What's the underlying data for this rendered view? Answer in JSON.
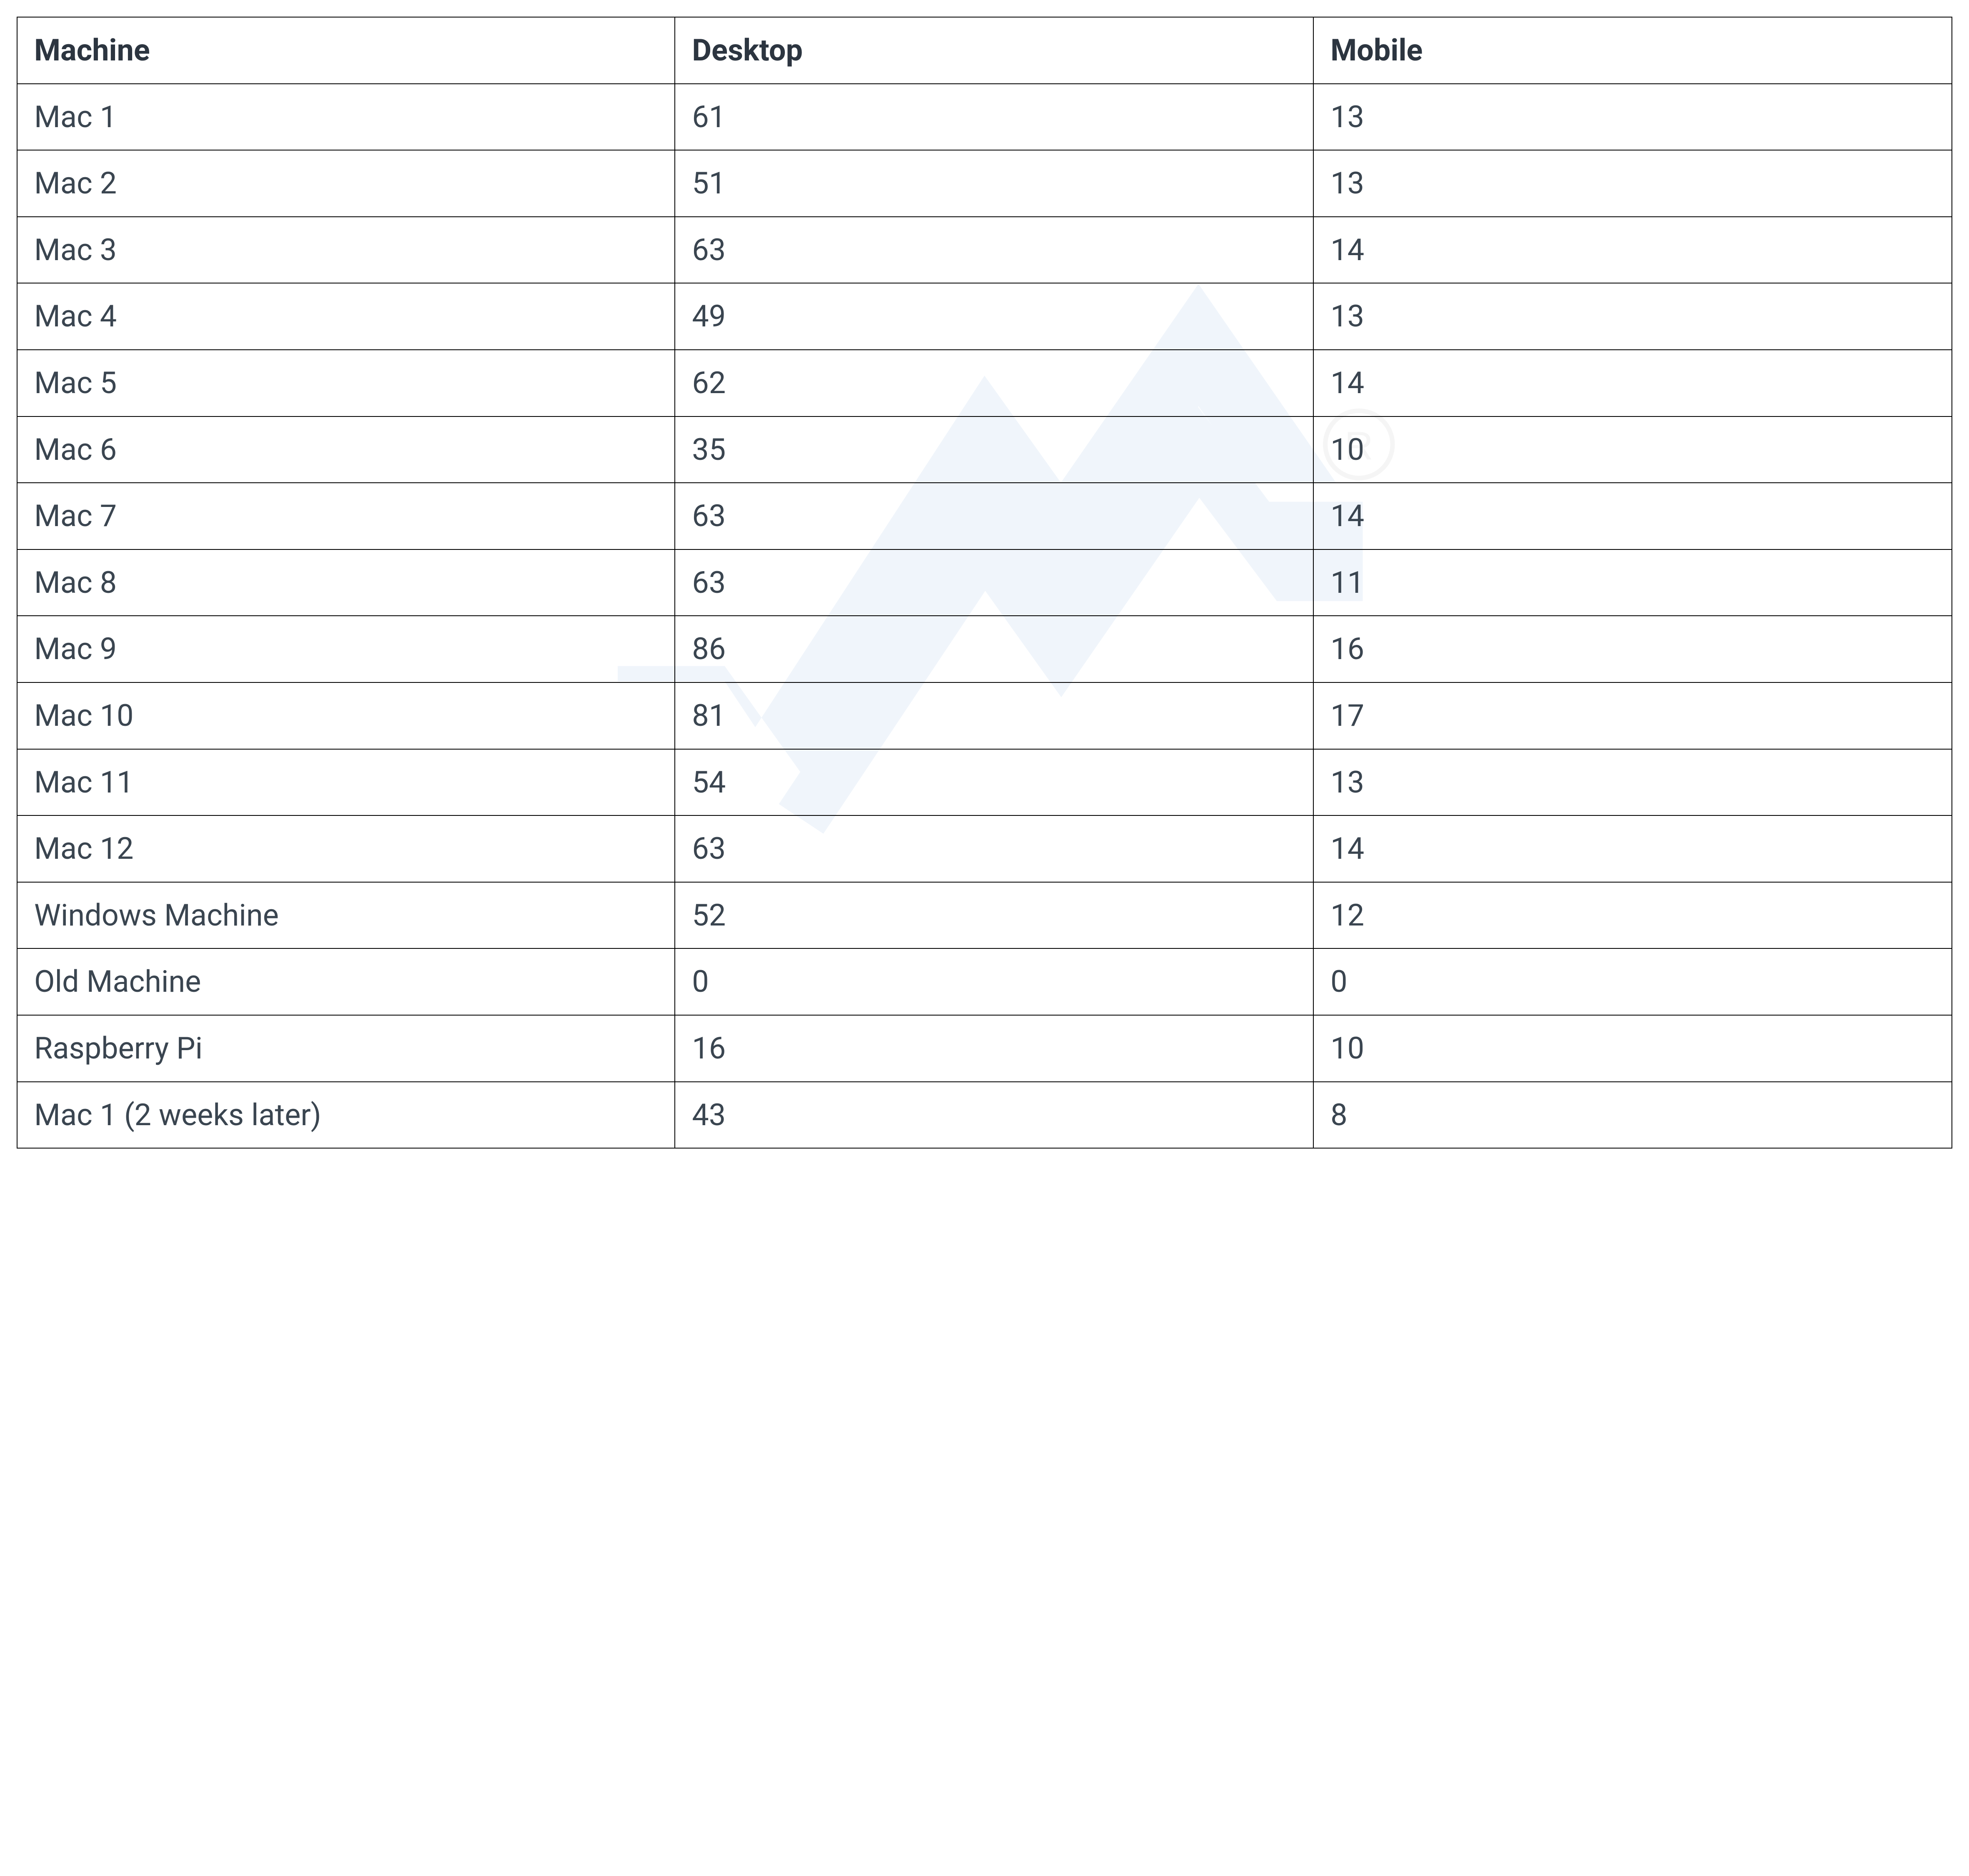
{
  "table": {
    "headers": {
      "machine": "Machine",
      "desktop": "Desktop",
      "mobile": "Mobile"
    },
    "rows": [
      {
        "machine": "Mac 1",
        "desktop": "61",
        "mobile": "13"
      },
      {
        "machine": "Mac 2",
        "desktop": "51",
        "mobile": "13"
      },
      {
        "machine": "Mac 3",
        "desktop": "63",
        "mobile": "14"
      },
      {
        "machine": "Mac 4",
        "desktop": "49",
        "mobile": "13"
      },
      {
        "machine": "Mac 5",
        "desktop": "62",
        "mobile": "14"
      },
      {
        "machine": "Mac 6",
        "desktop": "35",
        "mobile": "10"
      },
      {
        "machine": "Mac 7",
        "desktop": "63",
        "mobile": "14"
      },
      {
        "machine": "Mac 8",
        "desktop": "63",
        "mobile": "11"
      },
      {
        "machine": "Mac 9",
        "desktop": "86",
        "mobile": "16"
      },
      {
        "machine": "Mac 10",
        "desktop": "81",
        "mobile": "17"
      },
      {
        "machine": "Mac 11",
        "desktop": "54",
        "mobile": "13"
      },
      {
        "machine": "Mac 12",
        "desktop": "63",
        "mobile": "14"
      },
      {
        "machine": "Windows Machine",
        "desktop": "52",
        "mobile": "12"
      },
      {
        "machine": "Old Machine",
        "desktop": "0",
        "mobile": "0"
      },
      {
        "machine": "Raspberry Pi",
        "desktop": "16",
        "mobile": "10"
      },
      {
        "machine": "Mac 1 (2 weeks later)",
        "desktop": "43",
        "mobile": "8"
      }
    ]
  },
  "watermark": {
    "registered_symbol": "®"
  }
}
